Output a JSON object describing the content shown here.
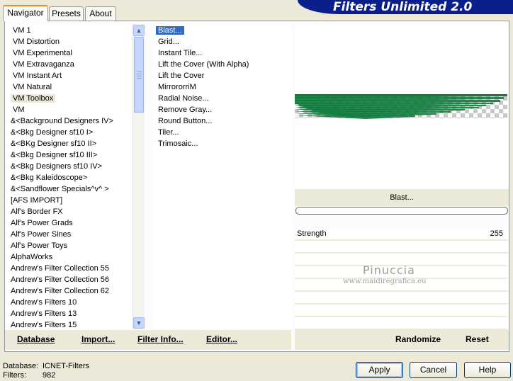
{
  "app": {
    "title": "Filters Unlimited 2.0"
  },
  "tabs": [
    {
      "label": "Navigator",
      "active": true
    },
    {
      "label": "Presets",
      "active": false
    },
    {
      "label": "About",
      "active": false
    }
  ],
  "categories": {
    "selected_index": 6,
    "items": [
      "VM 1",
      "VM Distortion",
      "VM Experimental",
      "VM Extravaganza",
      "VM Instant Art",
      "VM Natural",
      "VM Toolbox",
      "VM",
      "&<Background Designers IV>",
      "&<Bkg Designer sf10 I>",
      "&<BKg Designer sf10 II>",
      "&<Bkg Designer sf10 III>",
      "&<Bkg Designers sf10 IV>",
      "&<Bkg Kaleidoscope>",
      "&<Sandflower Specials^v^ >",
      "[AFS IMPORT]",
      "Alf's Border FX",
      "Alf's Power Grads",
      "Alf's Power Sines",
      "Alf's Power Toys",
      "AlphaWorks",
      "Andrew's Filter Collection 55",
      "Andrew's Filter Collection 56",
      "Andrew's Filter Collection 62",
      "Andrew's Filters 10",
      "Andrew's Filters 13",
      "Andrew's Filters 15"
    ]
  },
  "scrollbar": {
    "up_glyph": "▲",
    "down_glyph": "▼"
  },
  "filters": {
    "selected_index": 0,
    "items": [
      "Blast...",
      "Grid...",
      "Instant Tile...",
      "Lift the Cover (With Alpha)",
      "Lift the Cover",
      "MirrororriM",
      "Radial Noise...",
      "Remove Gray...",
      "Round Button...",
      "Tiler...",
      "Trimosaic..."
    ]
  },
  "preview": {
    "filter_name": "Blast...",
    "accent_color": "#0e7a3c"
  },
  "sliders": [
    {
      "label": "Strength",
      "value": "255"
    },
    {
      "label": "",
      "value": ""
    },
    {
      "label": "",
      "value": ""
    },
    {
      "label": "",
      "value": ""
    },
    {
      "label": "",
      "value": ""
    },
    {
      "label": "",
      "value": ""
    },
    {
      "label": "",
      "value": ""
    },
    {
      "label": "",
      "value": ""
    }
  ],
  "watermark": {
    "line1": "Pinuccia",
    "line2": "www.maidiregrafica.eu"
  },
  "toolbar_left": {
    "database": {
      "label": "Database"
    },
    "import": {
      "label": "Import..."
    },
    "filter_info": {
      "label": "Filter Info..."
    },
    "editor": {
      "label": "Editor..."
    }
  },
  "toolbar_right": {
    "randomize": {
      "label": "Randomize"
    },
    "reset": {
      "label": "Reset"
    }
  },
  "footer": {
    "database_label": "Database:",
    "database_value": "ICNET-Filters",
    "filters_label": "Filters:",
    "filters_value": "982"
  },
  "buttons": {
    "apply": "Apply",
    "cancel": "Cancel",
    "help": "Help"
  }
}
